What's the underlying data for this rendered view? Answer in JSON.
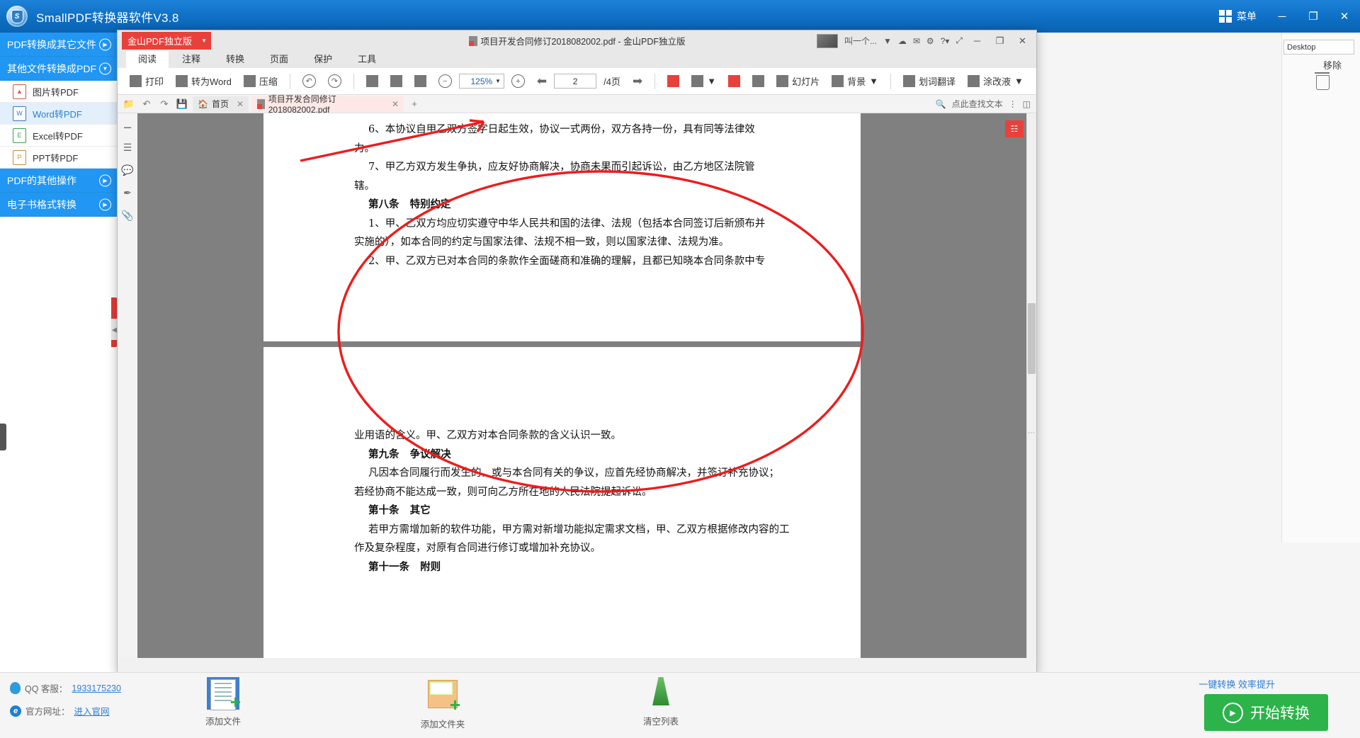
{
  "app": {
    "title": "SmallPDF转换器软件V3.8",
    "menu_label": "菜单",
    "minimize": "─",
    "maximize": "❐",
    "close": "✕"
  },
  "sidebar": {
    "categories": [
      {
        "label": "PDF转换成其它文件",
        "expanded": false
      },
      {
        "label": "其他文件转换成PDF",
        "expanded": true
      },
      {
        "label": "PDF的其他操作",
        "expanded": false
      },
      {
        "label": "电子书格式转换",
        "expanded": false
      }
    ],
    "items": [
      {
        "label": "图片转PDF",
        "icon": "image-icon",
        "glyph": "▣",
        "active": false
      },
      {
        "label": "Word转PDF",
        "icon": "word-icon",
        "glyph": "W",
        "active": true
      },
      {
        "label": "Excel转PDF",
        "icon": "excel-icon",
        "glyph": "E",
        "active": false
      },
      {
        "label": "PPT转PDF",
        "icon": "ppt-icon",
        "glyph": "P",
        "active": false
      }
    ]
  },
  "right_panel": {
    "path_value": "Desktop",
    "remove_label": "移除"
  },
  "pdf_window": {
    "brand_tab": "金山PDF独立版",
    "doc_title": "项目开发合同修订2018082002.pdf - 金山PDF独立版",
    "account_label": "叫一个...",
    "minimize": "─",
    "maximize": "❐",
    "close": "✕",
    "ribbon_tabs": [
      {
        "label": "阅读",
        "active": true
      },
      {
        "label": "注释",
        "active": false
      },
      {
        "label": "转换",
        "active": false
      },
      {
        "label": "页面",
        "active": false
      },
      {
        "label": "保护",
        "active": false
      },
      {
        "label": "工具",
        "active": false
      }
    ],
    "toolbar": {
      "print": "打印",
      "to_word": "转为Word",
      "compress": "压缩",
      "undo_icon": "undo-icon",
      "redo_icon": "redo-icon",
      "actual_size": "1:1",
      "fit_width_icon": "fit-width-icon",
      "fit_page_icon": "fit-page-icon",
      "zoom_out_icon": "zoom-out-icon",
      "zoom_value": "125%",
      "zoom_in_icon": "zoom-in-icon",
      "prev_page_icon": "prev-page-icon",
      "page_value": "2",
      "page_total": "/4页",
      "next_page_icon": "next-page-icon",
      "single_page_icon": "single-page-icon",
      "facing_icon": "facing-page-icon",
      "continuous_icon": "continuous-scroll-icon",
      "fullscreen_icon": "fullscreen-icon",
      "slideshow": "幻灯片",
      "background": "背景",
      "translate": "划词翻译",
      "whiteout": "涂改液"
    },
    "doc_tabs": {
      "open_icon": "open-folder-icon",
      "undo_icon": "undo-icon",
      "redo_icon": "redo-icon",
      "save_icon": "save-icon",
      "home_tab": "首页",
      "file_tab": "项目开发合同修订2018082002.pdf",
      "new_tab": "+",
      "search_placeholder": "点此查找文本",
      "more_icon": "more-options-icon",
      "panel_icon": "side-panel-icon"
    },
    "rail_icons": [
      "collapse-icon",
      "thumbnails-icon",
      "comments-icon",
      "signature-icon",
      "attachments-icon"
    ],
    "page_badge_icon": "compare-icon"
  },
  "document": {
    "page1_lines": [
      {
        "text": "6、本协议自甲乙双方签字日起生效，协议一式两份，双方各持一份，具有同等法律效",
        "indent": 1,
        "bold": false
      },
      {
        "text": "力。",
        "indent": 0,
        "bold": false
      },
      {
        "text": "7、甲乙方双方发生争执，应友好协商解决，协商未果而引起诉讼，由乙方地区法院管",
        "indent": 1,
        "bold": false
      },
      {
        "text": "辖。",
        "indent": 0,
        "bold": false
      },
      {
        "text": "第八条   特别约定",
        "indent": 1,
        "bold": true
      },
      {
        "text": "1、甲、乙双方均应切实遵守中华人民共和国的法律、法规（包括本合同签订后新颁布并",
        "indent": 1,
        "bold": false
      },
      {
        "text": "实施的），如本合同的约定与国家法律、法规不相一致，则以国家法律、法规为准。",
        "indent": 0,
        "bold": false
      },
      {
        "text": "2、甲、乙双方已对本合同的条款作全面磋商和准确的理解，且都已知晓本合同条款中专",
        "indent": 1,
        "bold": false
      }
    ],
    "page2_lines": [
      {
        "text": "业用语的含义。甲、乙双方对本合同条款的含义认识一致。",
        "indent": 0,
        "bold": false
      },
      {
        "text": "第九条   争议解决",
        "indent": 1,
        "bold": true
      },
      {
        "text": "凡因本合同履行而发生的，或与本合同有关的争议，应首先经协商解决，并签订补充协议；",
        "indent": 1,
        "bold": false
      },
      {
        "text": "若经协商不能达成一致，则可向乙方所在地的人民法院提起诉讼。",
        "indent": 0,
        "bold": false
      },
      {
        "text": "第十条   其它",
        "indent": 1,
        "bold": true
      },
      {
        "text": "若甲方需增加新的软件功能，甲方需对新增功能拟定需求文档，甲、乙双方根据修改内容的工",
        "indent": 1,
        "bold": false
      },
      {
        "text": "作及复杂程度，对原有合同进行修订或增加补充协议。",
        "indent": 0,
        "bold": false
      },
      {
        "text": "第十一条   附则",
        "indent": 1,
        "bold": true
      }
    ],
    "annotation_color": "#ee1c1c"
  },
  "bottom": {
    "qq_label": "QQ 客服：",
    "qq_number": "1933175230",
    "site_label": "官方网址：",
    "site_link": "进入官网",
    "tools": [
      {
        "label": "添加文件",
        "icon": "add-file-icon"
      },
      {
        "label": "添加文件夹",
        "icon": "add-folder-icon"
      },
      {
        "label": "清空列表",
        "icon": "clear-list-icon"
      }
    ],
    "promo": "一键转换  效率提升",
    "convert_label": "开始转换"
  }
}
